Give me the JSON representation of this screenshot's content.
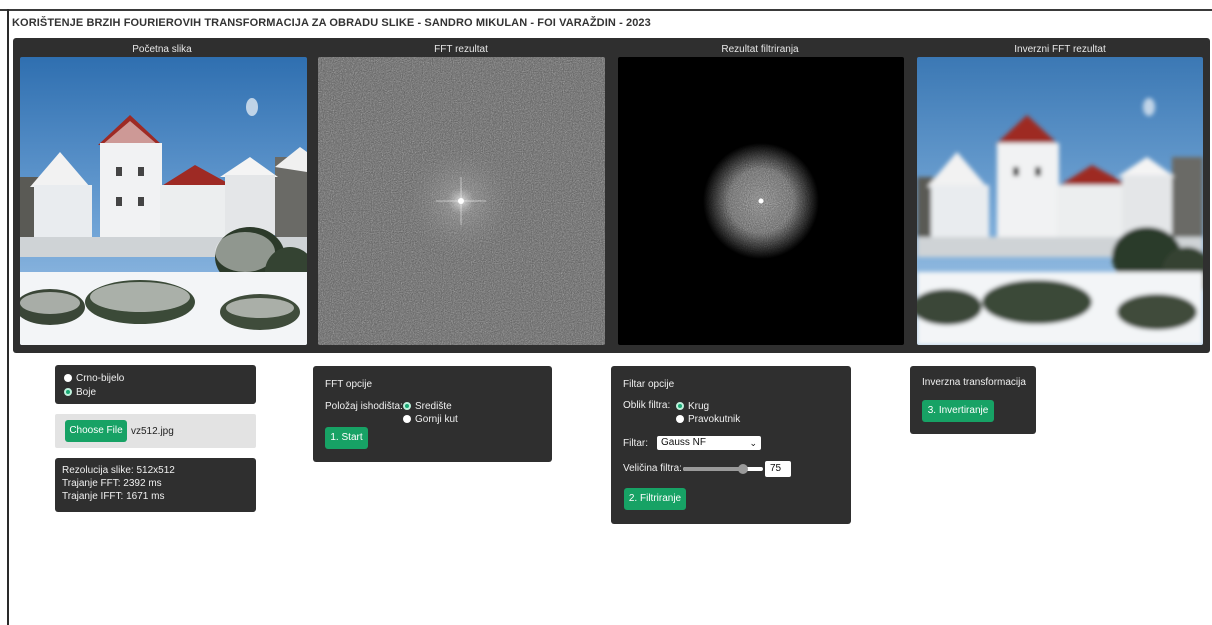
{
  "title": "KORIŠTENJE BRZIH FOURIEROVIH TRANSFORMACIJA ZA OBRADU SLIKE - SANDRO MIKULAN - FOI VARAŽDIN - 2023",
  "panels": [
    {
      "title": "Početna slika"
    },
    {
      "title": "FFT rezultat"
    },
    {
      "title": "Rezultat filtriranja"
    },
    {
      "title": "Inverzni FFT rezultat"
    }
  ],
  "color_mode": {
    "options": [
      "Crno-bijelo",
      "Boje"
    ],
    "selected": "Boje"
  },
  "file": {
    "button_label": "Choose File",
    "file_name": "vz512.jpg"
  },
  "info": {
    "resolution": "Rezolucija slike: 512x512",
    "fft_time": "Trajanje FFT: 2392 ms",
    "ifft_time": "Trajanje IFFT: 1671 ms"
  },
  "fft_options": {
    "heading": "FFT opcije",
    "origin_label": "Položaj ishodišta:",
    "origin_options": [
      "Središte",
      "Gornji kut"
    ],
    "origin_selected": "Središte",
    "start_button": "1. Start"
  },
  "filter_options": {
    "heading": "Filtar opcije",
    "shape_label": "Oblik filtra:",
    "shape_options": [
      "Krug",
      "Pravokutnik"
    ],
    "shape_selected": "Krug",
    "filter_label": "Filtar:",
    "filter_value": "Gauss NF",
    "size_label": "Veličina filtra:",
    "size_value": "75",
    "size_fraction": 0.75,
    "filter_button": "2. Filtriranje"
  },
  "inverse": {
    "heading": "Inverzna transformacija",
    "button": "3. Invertiranje"
  },
  "colors": {
    "panel_bg": "#2f2f2f",
    "accent_green": "#17a265",
    "radio_selected": "#19a974"
  }
}
